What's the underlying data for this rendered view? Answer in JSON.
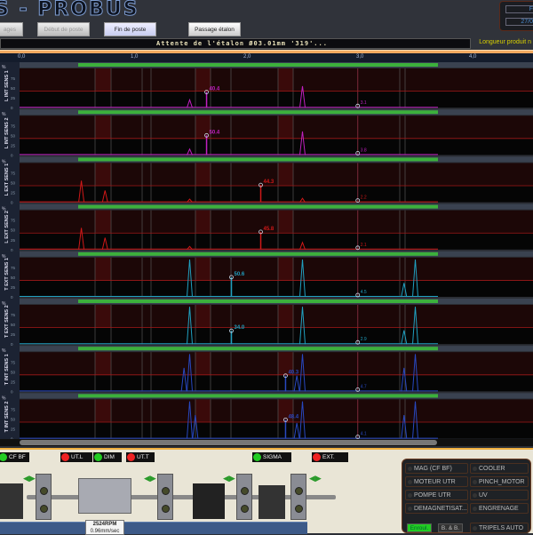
{
  "header": {
    "title": "S - PROBUS",
    "buttons": [
      "ages",
      "Début de poste",
      "Fin de poste",
      "Passage étalon"
    ],
    "status": "Attente de l'étalon Ø03.01mm '319'...",
    "longueur": "Longueur produit n",
    "clock": [
      "F",
      "27/0"
    ]
  },
  "axis_ticks": [
    "0,0",
    "1,0",
    "2,0",
    "3,0",
    "4,0"
  ],
  "chart_data": {
    "type": "line",
    "xlabel": "",
    "ylabel": "%",
    "xlim": [
      0,
      4.6
    ],
    "ylim": [
      0,
      100
    ],
    "yticks": [
      "%",
      "75",
      "50",
      "25",
      "0"
    ],
    "threshold": 42,
    "channels": [
      {
        "label": "L INT SENS 1",
        "color": "#c020c0",
        "value": "40.4",
        "peak_x": 1.65,
        "peak": 40,
        "marker_x": 2.99,
        "marker": "3.1",
        "others": [
          [
            1.5,
            20
          ],
          [
            2.5,
            55
          ]
        ]
      },
      {
        "label": "L INT SENS 2",
        "color": "#c020c0",
        "value": "50.4",
        "peak_x": 1.65,
        "peak": 50,
        "marker_x": 2.99,
        "marker": "3.8",
        "others": [
          [
            1.5,
            15
          ],
          [
            2.5,
            60
          ]
        ]
      },
      {
        "label": "L EXT SENS 1",
        "color": "#d01818",
        "value": "44.3",
        "peak_x": 2.13,
        "peak": 44,
        "marker_x": 2.99,
        "marker": "2.2",
        "others": [
          [
            0.54,
            55
          ],
          [
            0.75,
            30
          ],
          [
            1.5,
            8
          ],
          [
            2.5,
            10
          ]
        ]
      },
      {
        "label": "L EXT SENS 2",
        "color": "#d01818",
        "value": "45.8",
        "peak_x": 2.13,
        "peak": 45,
        "marker_x": 2.99,
        "marker": "2.1",
        "others": [
          [
            0.54,
            55
          ],
          [
            0.75,
            30
          ],
          [
            1.5,
            8
          ],
          [
            2.5,
            18
          ]
        ]
      },
      {
        "label": "T EXT SENS 1",
        "color": "#20a0c0",
        "value": "50.6",
        "peak_x": 1.87,
        "peak": 50,
        "marker_x": 2.99,
        "marker": "4.5",
        "others": [
          [
            1.5,
            95
          ],
          [
            2.5,
            95
          ],
          [
            3.4,
            35
          ],
          [
            3.5,
            95
          ]
        ]
      },
      {
        "label": "T EXT SENS 2",
        "color": "#20a0c0",
        "value": "34.0",
        "peak_x": 1.87,
        "peak": 34,
        "marker_x": 2.99,
        "marker": "2.9",
        "others": [
          [
            1.5,
            95
          ],
          [
            2.5,
            95
          ],
          [
            3.4,
            35
          ],
          [
            3.5,
            95
          ]
        ]
      },
      {
        "label": "T INT SENS 1",
        "color": "#2848c0",
        "value": "40.3",
        "peak_x": 2.35,
        "peak": 40,
        "marker_x": 2.99,
        "marker": "4.7",
        "others": [
          [
            1.5,
            95
          ],
          [
            1.45,
            60
          ],
          [
            2.5,
            95
          ],
          [
            2.45,
            40
          ],
          [
            3.4,
            60
          ],
          [
            3.5,
            95
          ]
        ]
      },
      {
        "label": "T INT SENS 2",
        "color": "#2848c0",
        "value": "48.4",
        "peak_x": 2.35,
        "peak": 48,
        "marker_x": 2.99,
        "marker": "4.1",
        "others": [
          [
            1.5,
            95
          ],
          [
            1.55,
            60
          ],
          [
            2.5,
            95
          ],
          [
            2.45,
            40
          ],
          [
            3.4,
            60
          ],
          [
            3.5,
            95
          ]
        ]
      }
    ]
  },
  "indicators": [
    {
      "label": "CF BF",
      "state": "green"
    },
    {
      "label": "UT.L",
      "state": "red"
    },
    {
      "label": "DIM",
      "state": "green"
    },
    {
      "label": "UT.T",
      "state": "red"
    },
    {
      "label": "SIGMA",
      "state": "green"
    },
    {
      "label": "EXT.",
      "state": "red"
    }
  ],
  "speed": {
    "rpm": "2524RPM",
    "feed": "0.96mm/sec"
  },
  "status_panel": {
    "items": [
      "MAG (CF BF)",
      "COOLER",
      "MOTEUR UTR",
      "PINCH_MOTOR",
      "POMPE UTR",
      "UV",
      "DEMAGNETISAT...",
      "ENGRENAGE"
    ],
    "last": "TRIPELS AUTO",
    "enroul": "Enroul.",
    "bb": "B. & B."
  }
}
